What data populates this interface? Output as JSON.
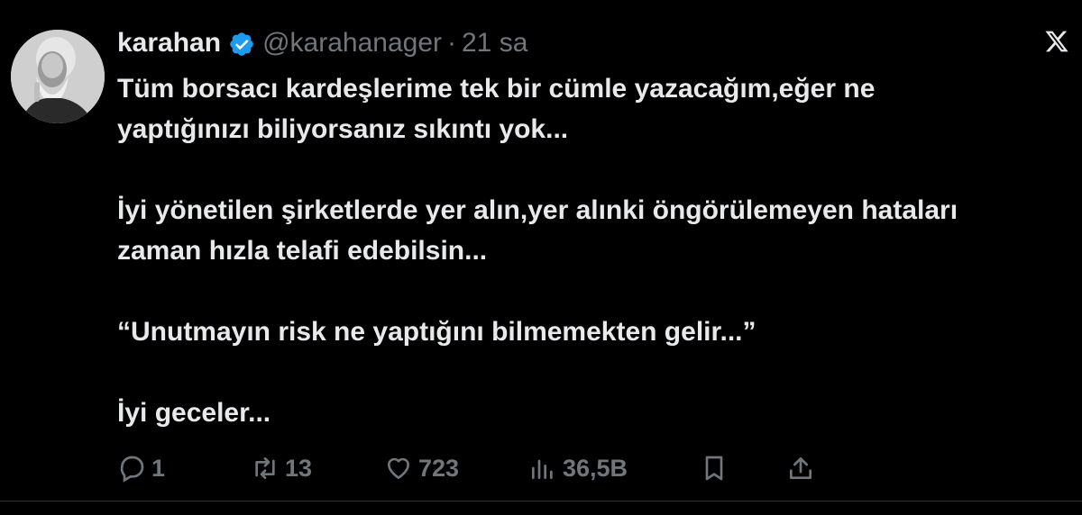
{
  "user": {
    "name": "karahan",
    "handle": "@karahanager",
    "separator": "·",
    "time": "21 sa",
    "verified_color": "#1d9bf0"
  },
  "tweet": {
    "line1": "Tüm borsacı kardeşlerime tek bir cümle yazacağım,eğer ne",
    "line2": "yaptığınızı biliyorsanız sıkıntı yok...",
    "line3": "İyi yönetilen şirketlerde yer alın,yer alınki öngörülemeyen hataları",
    "line4": "zaman hızla telafi edebilsin...",
    "line5": "“Unutmayın risk ne yaptığını bilmemekten gelir...”",
    "line6": "İyi geceler..."
  },
  "actions": {
    "reply_count": "1",
    "repost_count": "13",
    "like_count": "723",
    "views_count": "36,5B"
  },
  "icons": {
    "avatar": "avatar-portrait",
    "verified": "verified-badge-icon",
    "close": "x-close-icon",
    "reply": "reply-icon",
    "repost": "repost-icon",
    "like": "heart-icon",
    "views": "views-chart-icon",
    "bookmark": "bookmark-icon",
    "share": "share-icon"
  },
  "colors": {
    "background": "#000000",
    "text": "#e7e9ea",
    "secondary": "#71767b"
  }
}
